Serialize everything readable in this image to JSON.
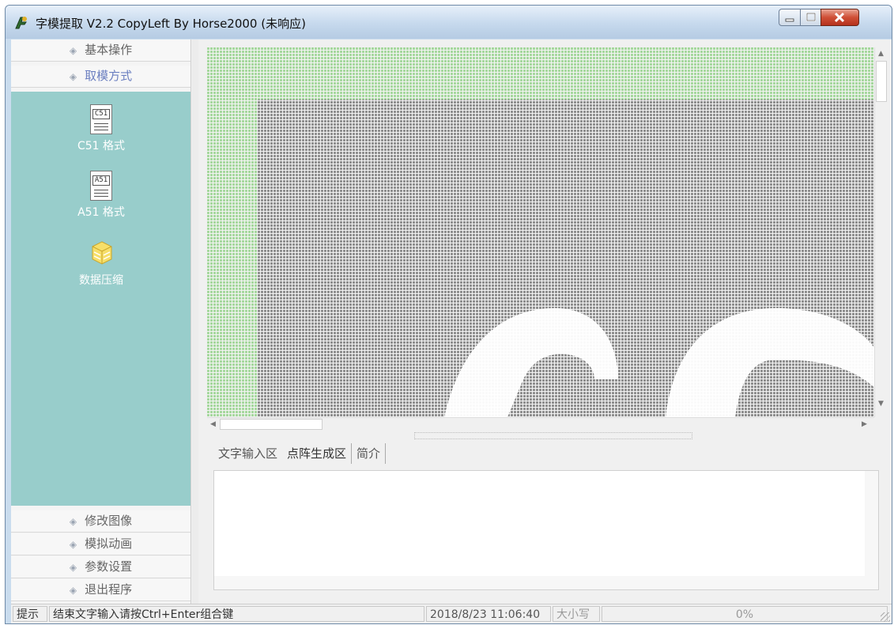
{
  "window": {
    "title": "字模提取 V2.2  CopyLeft By Horse2000 (未响应)"
  },
  "sidebar": {
    "top_items": [
      {
        "label": "基本操作"
      },
      {
        "label": "取模方式"
      }
    ],
    "tools": [
      {
        "label": "C51 格式",
        "icon": "c51-document-icon",
        "icon_text": "C51"
      },
      {
        "label": "A51 格式",
        "icon": "a51-document-icon",
        "icon_text": "A51"
      },
      {
        "label": "数据压缩",
        "icon": "data-compress-icon"
      }
    ],
    "bottom_items": [
      {
        "label": "修改图像"
      },
      {
        "label": "模拟动画"
      },
      {
        "label": "参数设置"
      },
      {
        "label": "退出程序"
      }
    ],
    "panel_color": "#98cdcb"
  },
  "tabs": [
    {
      "label": "文字输入区"
    },
    {
      "label": "点阵生成区"
    },
    {
      "label": "简介"
    }
  ],
  "statusbar": {
    "hint_label": "提示",
    "message": "结束文字输入请按Ctrl+Enter组合键",
    "datetime": "2018/8/23 11:06:40",
    "caps": "大小写",
    "progress": "0%"
  },
  "colors": {
    "pixel_grid_bg": "#9a9a9a",
    "pixel_margin": "#a8d8a0",
    "pixel_on": "#ffffff"
  }
}
